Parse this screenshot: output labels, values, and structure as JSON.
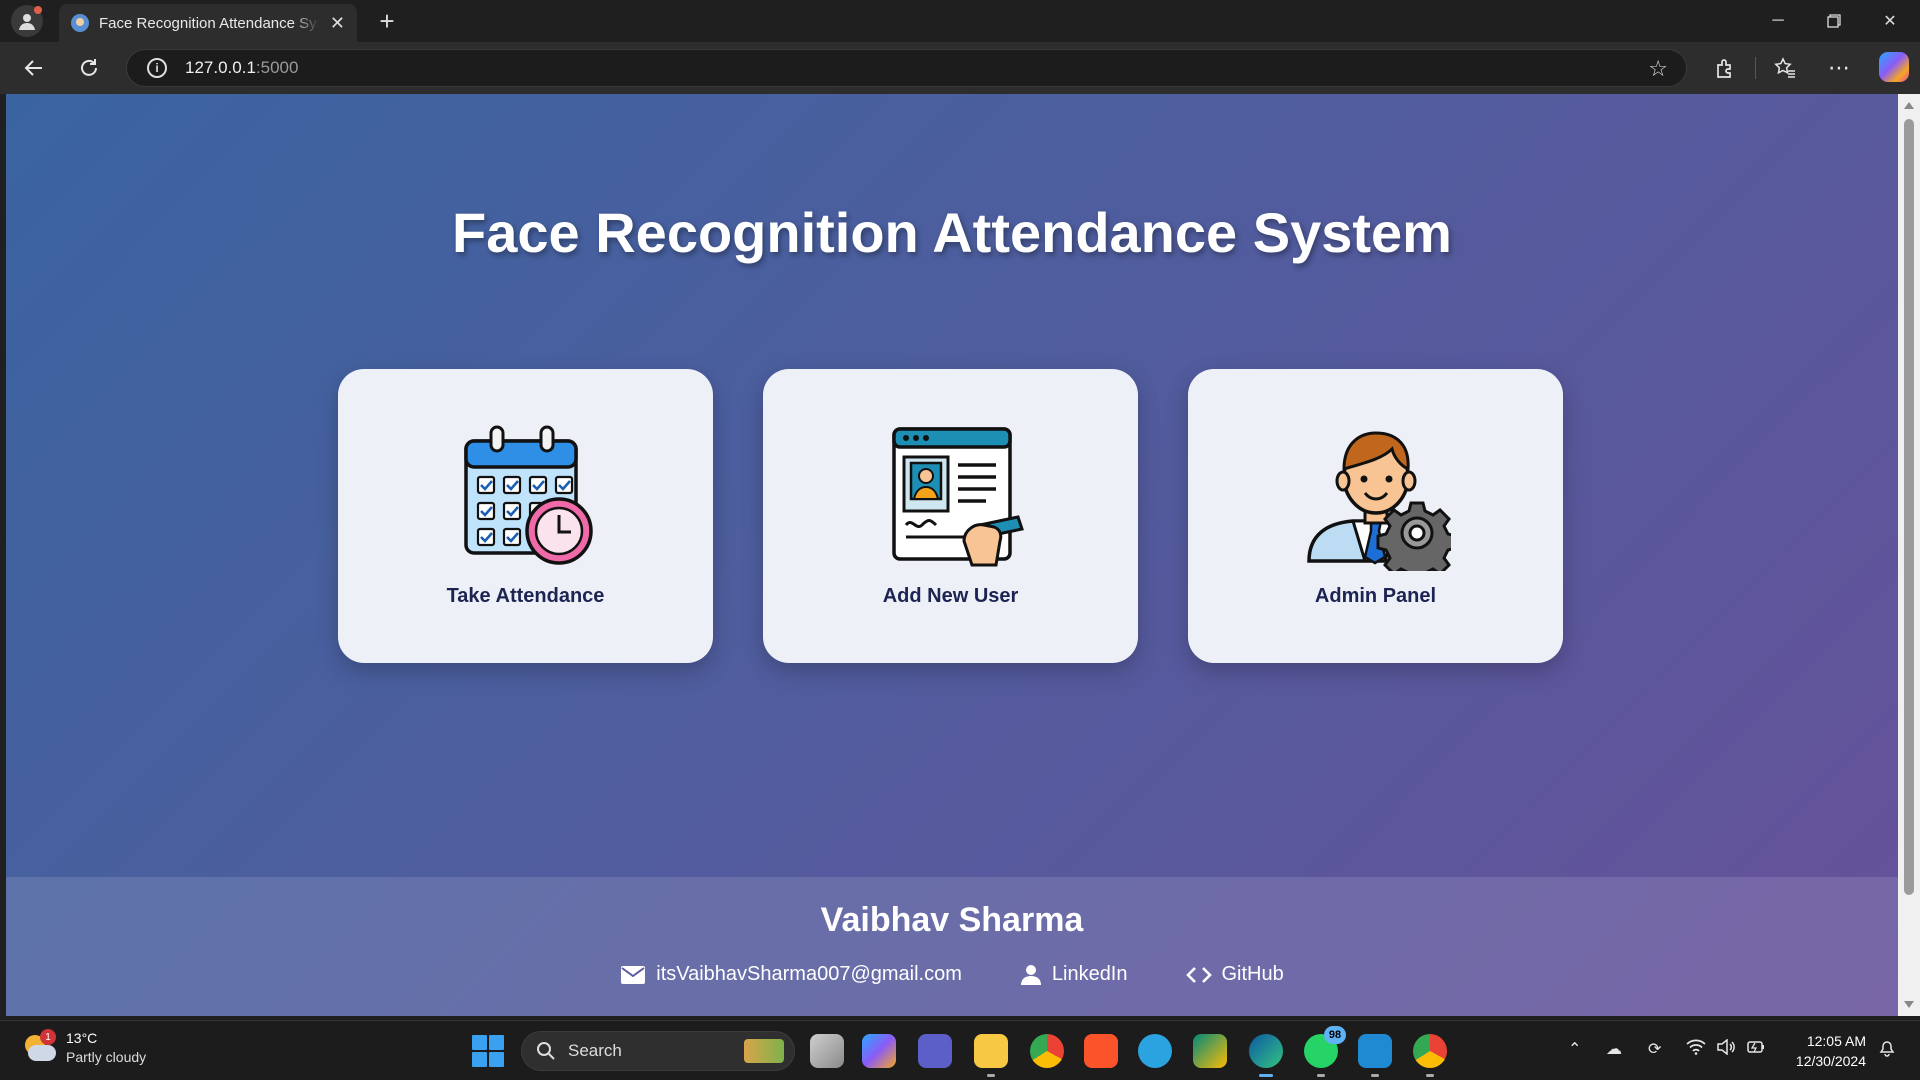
{
  "browser": {
    "tab_title": "Face Recognition Attendance System",
    "url_host": "127.0.0.1",
    "url_port": ":5000",
    "new_tab_label": "+"
  },
  "page": {
    "title": "Face Recognition Attendance System",
    "cards": [
      {
        "label": "Take Attendance",
        "icon": "calendar-clock-icon"
      },
      {
        "label": "Add New User",
        "icon": "user-form-icon"
      },
      {
        "label": "Admin Panel",
        "icon": "admin-gear-icon"
      }
    ],
    "footer": {
      "name": "Vaibhav Sharma",
      "email": "itsVaibhavSharma007@gmail.com",
      "linkedin": "LinkedIn",
      "github": "GitHub"
    }
  },
  "taskbar": {
    "weather_temp": "13°C",
    "weather_desc": "Partly cloudy",
    "weather_badge": "1",
    "search_label": "Search",
    "whatsapp_badge": "98",
    "time": "12:05 AM",
    "date": "12/30/2024"
  },
  "colors": {
    "gradient_start": "#3a64a0",
    "gradient_end": "#66519a",
    "card_bg": "#eef0f8",
    "card_text": "#1c2452"
  }
}
